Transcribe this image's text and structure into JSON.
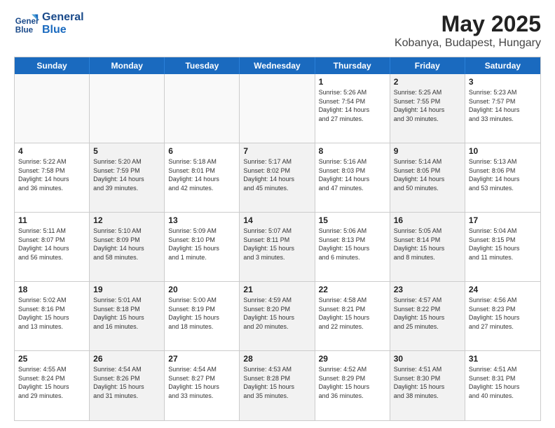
{
  "logo": {
    "line1": "General",
    "line2": "Blue"
  },
  "title": "May 2025",
  "subtitle": "Kobanya, Budapest, Hungary",
  "headers": [
    "Sunday",
    "Monday",
    "Tuesday",
    "Wednesday",
    "Thursday",
    "Friday",
    "Saturday"
  ],
  "weeks": [
    [
      {
        "day": "",
        "text": "",
        "empty": true
      },
      {
        "day": "",
        "text": "",
        "empty": true
      },
      {
        "day": "",
        "text": "",
        "empty": true
      },
      {
        "day": "",
        "text": "",
        "empty": true
      },
      {
        "day": "1",
        "text": "Sunrise: 5:26 AM\nSunset: 7:54 PM\nDaylight: 14 hours\nand 27 minutes.",
        "shaded": false
      },
      {
        "day": "2",
        "text": "Sunrise: 5:25 AM\nSunset: 7:55 PM\nDaylight: 14 hours\nand 30 minutes.",
        "shaded": true
      },
      {
        "day": "3",
        "text": "Sunrise: 5:23 AM\nSunset: 7:57 PM\nDaylight: 14 hours\nand 33 minutes.",
        "shaded": false
      }
    ],
    [
      {
        "day": "4",
        "text": "Sunrise: 5:22 AM\nSunset: 7:58 PM\nDaylight: 14 hours\nand 36 minutes.",
        "shaded": false
      },
      {
        "day": "5",
        "text": "Sunrise: 5:20 AM\nSunset: 7:59 PM\nDaylight: 14 hours\nand 39 minutes.",
        "shaded": true
      },
      {
        "day": "6",
        "text": "Sunrise: 5:18 AM\nSunset: 8:01 PM\nDaylight: 14 hours\nand 42 minutes.",
        "shaded": false
      },
      {
        "day": "7",
        "text": "Sunrise: 5:17 AM\nSunset: 8:02 PM\nDaylight: 14 hours\nand 45 minutes.",
        "shaded": true
      },
      {
        "day": "8",
        "text": "Sunrise: 5:16 AM\nSunset: 8:03 PM\nDaylight: 14 hours\nand 47 minutes.",
        "shaded": false
      },
      {
        "day": "9",
        "text": "Sunrise: 5:14 AM\nSunset: 8:05 PM\nDaylight: 14 hours\nand 50 minutes.",
        "shaded": true
      },
      {
        "day": "10",
        "text": "Sunrise: 5:13 AM\nSunset: 8:06 PM\nDaylight: 14 hours\nand 53 minutes.",
        "shaded": false
      }
    ],
    [
      {
        "day": "11",
        "text": "Sunrise: 5:11 AM\nSunset: 8:07 PM\nDaylight: 14 hours\nand 56 minutes.",
        "shaded": false
      },
      {
        "day": "12",
        "text": "Sunrise: 5:10 AM\nSunset: 8:09 PM\nDaylight: 14 hours\nand 58 minutes.",
        "shaded": true
      },
      {
        "day": "13",
        "text": "Sunrise: 5:09 AM\nSunset: 8:10 PM\nDaylight: 15 hours\nand 1 minute.",
        "shaded": false
      },
      {
        "day": "14",
        "text": "Sunrise: 5:07 AM\nSunset: 8:11 PM\nDaylight: 15 hours\nand 3 minutes.",
        "shaded": true
      },
      {
        "day": "15",
        "text": "Sunrise: 5:06 AM\nSunset: 8:13 PM\nDaylight: 15 hours\nand 6 minutes.",
        "shaded": false
      },
      {
        "day": "16",
        "text": "Sunrise: 5:05 AM\nSunset: 8:14 PM\nDaylight: 15 hours\nand 8 minutes.",
        "shaded": true
      },
      {
        "day": "17",
        "text": "Sunrise: 5:04 AM\nSunset: 8:15 PM\nDaylight: 15 hours\nand 11 minutes.",
        "shaded": false
      }
    ],
    [
      {
        "day": "18",
        "text": "Sunrise: 5:02 AM\nSunset: 8:16 PM\nDaylight: 15 hours\nand 13 minutes.",
        "shaded": false
      },
      {
        "day": "19",
        "text": "Sunrise: 5:01 AM\nSunset: 8:18 PM\nDaylight: 15 hours\nand 16 minutes.",
        "shaded": true
      },
      {
        "day": "20",
        "text": "Sunrise: 5:00 AM\nSunset: 8:19 PM\nDaylight: 15 hours\nand 18 minutes.",
        "shaded": false
      },
      {
        "day": "21",
        "text": "Sunrise: 4:59 AM\nSunset: 8:20 PM\nDaylight: 15 hours\nand 20 minutes.",
        "shaded": true
      },
      {
        "day": "22",
        "text": "Sunrise: 4:58 AM\nSunset: 8:21 PM\nDaylight: 15 hours\nand 22 minutes.",
        "shaded": false
      },
      {
        "day": "23",
        "text": "Sunrise: 4:57 AM\nSunset: 8:22 PM\nDaylight: 15 hours\nand 25 minutes.",
        "shaded": true
      },
      {
        "day": "24",
        "text": "Sunrise: 4:56 AM\nSunset: 8:23 PM\nDaylight: 15 hours\nand 27 minutes.",
        "shaded": false
      }
    ],
    [
      {
        "day": "25",
        "text": "Sunrise: 4:55 AM\nSunset: 8:24 PM\nDaylight: 15 hours\nand 29 minutes.",
        "shaded": false
      },
      {
        "day": "26",
        "text": "Sunrise: 4:54 AM\nSunset: 8:26 PM\nDaylight: 15 hours\nand 31 minutes.",
        "shaded": true
      },
      {
        "day": "27",
        "text": "Sunrise: 4:54 AM\nSunset: 8:27 PM\nDaylight: 15 hours\nand 33 minutes.",
        "shaded": false
      },
      {
        "day": "28",
        "text": "Sunrise: 4:53 AM\nSunset: 8:28 PM\nDaylight: 15 hours\nand 35 minutes.",
        "shaded": true
      },
      {
        "day": "29",
        "text": "Sunrise: 4:52 AM\nSunset: 8:29 PM\nDaylight: 15 hours\nand 36 minutes.",
        "shaded": false
      },
      {
        "day": "30",
        "text": "Sunrise: 4:51 AM\nSunset: 8:30 PM\nDaylight: 15 hours\nand 38 minutes.",
        "shaded": true
      },
      {
        "day": "31",
        "text": "Sunrise: 4:51 AM\nSunset: 8:31 PM\nDaylight: 15 hours\nand 40 minutes.",
        "shaded": false
      }
    ]
  ]
}
